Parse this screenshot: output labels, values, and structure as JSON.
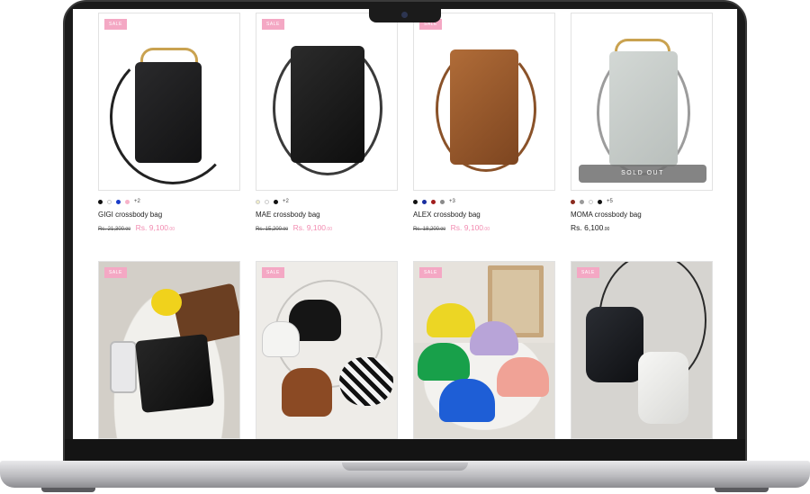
{
  "products_row1": [
    {
      "sale": "SALE",
      "title": "GIGI crossbody bag",
      "old_price": "Rs. 21,300",
      "old_cents": ".00",
      "new_price": "Rs. 9,100",
      "new_cents": ".00",
      "more": "+2",
      "swatches": [
        "#111111",
        "#ffffff",
        "#1a3cc9",
        "#f7b3c9"
      ],
      "bag_color": "#1d1d1f"
    },
    {
      "sale": "SALE",
      "title": "MAE crossbody bag",
      "old_price": "Rs. 15,200",
      "old_cents": ".00",
      "new_price": "Rs. 9,100",
      "new_cents": ".00",
      "more": "+2",
      "swatches": [
        "#f3efc9",
        "#ffffff",
        "#111111"
      ],
      "bag_color": "#151515"
    },
    {
      "sale": "SALE",
      "title": "ALEX crossbody bag",
      "old_price": "Rs. 18,200",
      "old_cents": ".00",
      "new_price": "Rs. 9,100",
      "new_cents": ".00",
      "more": "+3",
      "swatches": [
        "#111111",
        "#1a2fa0",
        "#a11d1d",
        "#8a8a8a"
      ],
      "bag_color": "#9a5a2e"
    },
    {
      "title": "MOMA crossbody bag",
      "price": "Rs. 6,100",
      "price_cents": ".00",
      "more": "+5",
      "soldout": "SOLD OUT",
      "swatches": [
        "#8b2a1e",
        "#9a9a9a",
        "#ffffff",
        "#111111"
      ],
      "bag_color": "#c8cdca"
    }
  ],
  "products_row2": [
    {
      "sale": "SALE"
    },
    {
      "sale": "SALE"
    },
    {
      "sale": "SALE"
    },
    {
      "sale": "SALE"
    }
  ]
}
